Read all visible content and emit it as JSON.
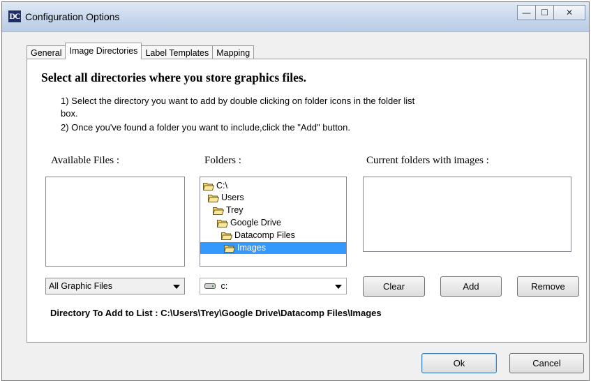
{
  "window": {
    "icon_text": "DC",
    "title": "Configuration Options",
    "controls": {
      "minimize": "—",
      "maximize": "☐",
      "close": "✕"
    }
  },
  "tabs": [
    {
      "label": "General"
    },
    {
      "label": "Image Directories"
    },
    {
      "label": "Label Templates"
    },
    {
      "label": "Mapping"
    }
  ],
  "content": {
    "heading": "Select all directories where you store graphics files.",
    "instructions": [
      "1) Select the directory you want to add by double clicking on folder icons in the folder list",
      "box.",
      "2) Once you've found a folder you want to include,click the \"Add\" button."
    ],
    "labels": {
      "available_files": "Available Files :",
      "folders": "Folders :",
      "current_folders": "Current folders with images :"
    },
    "folder_tree": [
      {
        "label": "C:\\",
        "selected": false
      },
      {
        "label": "Users",
        "selected": false
      },
      {
        "label": "Trey",
        "selected": false
      },
      {
        "label": "Google Drive",
        "selected": false
      },
      {
        "label": "Datacomp Files",
        "selected": false
      },
      {
        "label": "Images",
        "selected": true
      }
    ],
    "file_type_select": {
      "value": "All Graphic Files"
    },
    "drive_select": {
      "value": "c:"
    },
    "buttons": {
      "clear": "Clear",
      "add": "Add",
      "remove": "Remove"
    },
    "directory_to_add": "Directory To Add to List : C:\\Users\\Trey\\Google Drive\\Datacomp Files\\Images"
  },
  "footer": {
    "ok": "Ok",
    "cancel": "Cancel"
  },
  "colors": {
    "selection": "#3399ff",
    "titlebar": "#c7d7ec",
    "folder": "#f2d46b"
  }
}
